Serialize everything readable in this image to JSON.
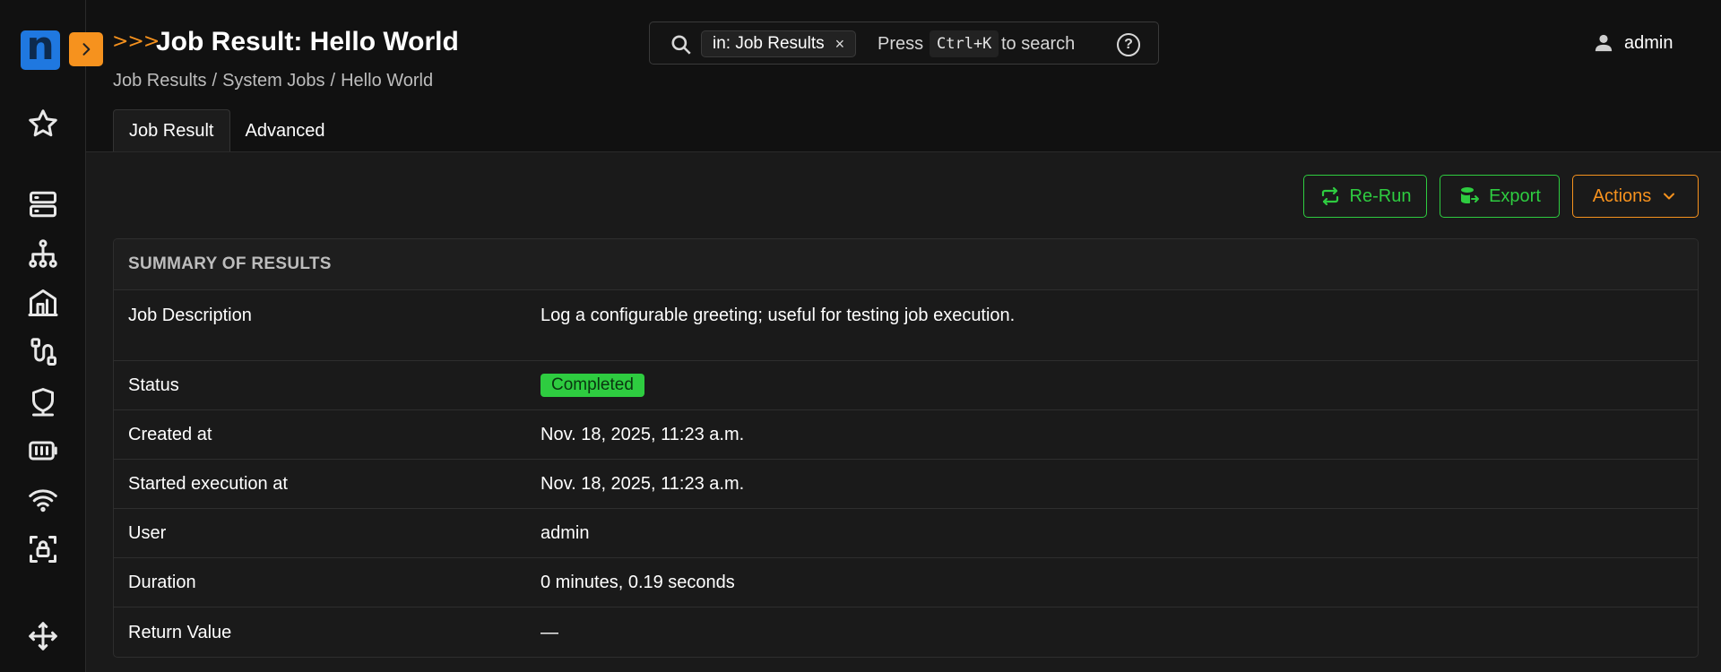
{
  "app": {
    "logo_letter": "n",
    "chevrons": ">>>",
    "page_title": "Job Result: Hello World",
    "breadcrumb": [
      "Job Results",
      "System Jobs",
      "Hello World"
    ]
  },
  "search": {
    "chip_label": "in: Job Results",
    "chip_close": "×",
    "press": "Press",
    "shortcut": "Ctrl+K",
    "to_search": "to search",
    "help": "?"
  },
  "user": {
    "name": "admin"
  },
  "sidebar": {
    "icons": [
      "star-icon",
      "server-icon",
      "org-tree-icon",
      "buildings-icon",
      "cable-icon",
      "shield-icon",
      "battery-icon",
      "wifi-icon",
      "lock-icon",
      "move-arrows-icon"
    ]
  },
  "tabs": [
    {
      "label": "Job Result",
      "active": true
    },
    {
      "label": "Advanced",
      "active": false
    }
  ],
  "toolbar": {
    "rerun": "Re-Run",
    "export": "Export",
    "actions": "Actions"
  },
  "summary": {
    "title": "SUMMARY OF RESULTS",
    "rows": [
      {
        "label": "Job Description",
        "value": "Log a configurable greeting; useful for testing job execution."
      },
      {
        "label": "Status",
        "value": "Completed"
      },
      {
        "label": "Created at",
        "value": "Nov. 18, 2025, 11:23 a.m."
      },
      {
        "label": "Started execution at",
        "value": "Nov. 18, 2025, 11:23 a.m."
      },
      {
        "label": "User",
        "value": "admin"
      },
      {
        "label": "Duration",
        "value": "0 minutes, 0.19 seconds"
      },
      {
        "label": "Return Value",
        "value": "—"
      }
    ]
  },
  "colors": {
    "accent_orange": "#f6921e",
    "success_green": "#2ecc40",
    "logo_blue": "#1f78e0",
    "background": "#111111"
  }
}
